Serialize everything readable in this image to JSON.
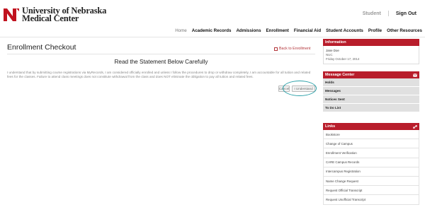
{
  "header": {
    "logo_line1": "University of Nebraska",
    "logo_line2": "Medical Center",
    "student_label": "Student",
    "signout_label": "Sign Out"
  },
  "nav": [
    "Home",
    "Academic Records",
    "Admissions",
    "Enrollment",
    "Financial Aid",
    "Student Accounts",
    "Profile",
    "Other Resources"
  ],
  "main": {
    "title": "Enrollment Checkout",
    "back_label": "Back to Enrollment",
    "statement_title": "Read the Statement Below Carefully",
    "statement_body": "I understand that by submitting course registrations via MyRecords, I am considered officially enrolled and unless I follow the procedures to drop or withdraw completely, I am accountable for all tuition and related fees for the classes. Failure to attend class meetings does not constitute withdrawal from the class and does NOT eliminate the obligation to pay all tuition and related fees.",
    "cancel_label": "Cancel",
    "understand_label": "I Understand"
  },
  "sidebar": {
    "info_header": "Information",
    "info_name": "Jane Doe",
    "info_org": "NUC",
    "info_date": "Friday October 17, 2014",
    "message_header": "Message Center",
    "message_items": [
      "Holds",
      "Messages",
      "Notices Sent",
      "To Do List"
    ],
    "links_header": "Links",
    "links_items": [
      "Bookstore",
      "Change of Campus",
      "Enrollment Verification",
      "CARE Campus Records",
      "Intercampus Registration",
      "Name Change Request",
      "Request Official Transcript",
      "Request Unofficial Transcript"
    ]
  },
  "colors": {
    "brand_red": "#b81d2b",
    "highlight_teal": "#2aa0a8"
  }
}
